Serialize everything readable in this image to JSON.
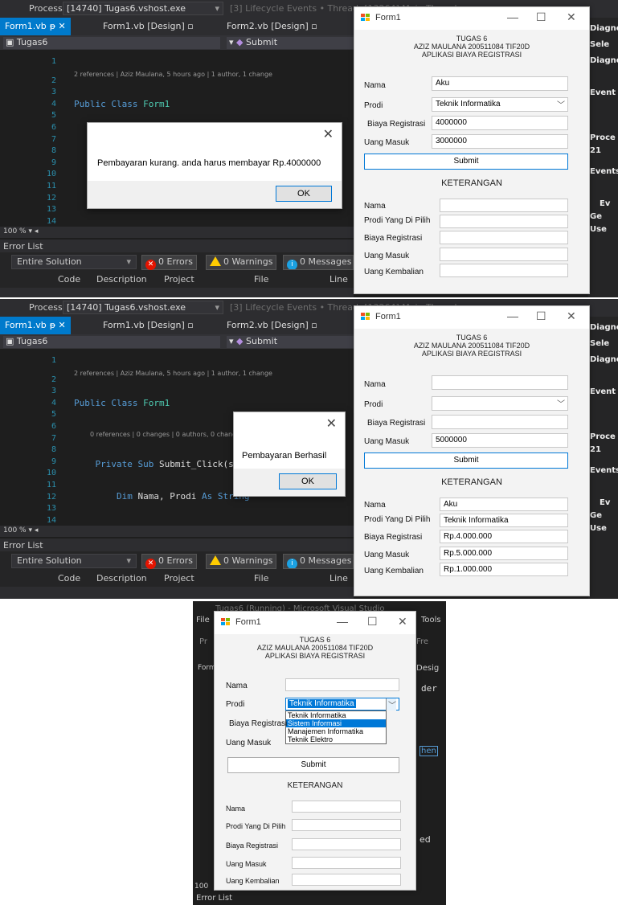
{
  "vs": {
    "process_label": "Process:",
    "process_value": "[14740] Tugas6.vshost.exe",
    "lifecycle": "[3] Lifecycle Events  •  Thread: [13264] Main Thread",
    "tabs": [
      "Form1.vb",
      "Form1.vb [Design]",
      "Form2.vb [Design]"
    ],
    "nav_left": "Tugas6",
    "nav_right": "Submit",
    "codelens_class": "2 references | Aziz Maulana, 5 hours ago | 1 author, 1 change",
    "codelens_sub": "0 references | 0 changes | 0 authors, 0 changes",
    "zoom": "100 %",
    "error_list": "Error List",
    "scope": "Entire Solution",
    "errors": "0 Errors",
    "warnings": "0 Warnings",
    "messages": "0 Messages",
    "cols": [
      "Code",
      "Description",
      "Project",
      "File",
      "Line"
    ],
    "right_panel": [
      "Diagnos",
      "Sele",
      "Diagno",
      "Event",
      "Proce",
      "21",
      "Events",
      "Ev",
      "Ge",
      "Use"
    ]
  },
  "form": {
    "title": "Form1",
    "heading1": "TUGAS 6",
    "heading2": "AZIZ MAULANA 200511084 TIF20D",
    "heading3": "APLIKASI BIAYA REGISTRASI",
    "lbl_nama": "Nama",
    "lbl_prodi": "Prodi",
    "lbl_biaya": "Biaya Registrasi",
    "lbl_uang": "Uang Masuk",
    "submit": "Submit",
    "keterangan": "KETERANGAN",
    "lbl_k_nama": "Nama",
    "lbl_k_prodi": "Prodi Yang Di Pilih",
    "lbl_k_biaya": "Biaya Registrasi",
    "lbl_k_uang": "Uang Masuk",
    "lbl_k_kembali": "Uang Kembalian"
  },
  "shot1": {
    "nama": "Aku",
    "prodi": "Teknik Informatika",
    "biaya": "4000000",
    "uang": "3000000",
    "k_nama": "",
    "k_prodi": "",
    "k_biaya": "",
    "k_uang": "",
    "k_kembali": "",
    "message": "Pembayaran kurang. anda harus membayar Rp.4000000",
    "ok": "OK",
    "code_lines": [
      "1",
      "2",
      "3",
      "4",
      "5",
      "6",
      "7",
      "8",
      "9",
      "10",
      "11",
      "12",
      "13",
      "14"
    ]
  },
  "shot2": {
    "nama": "",
    "prodi": "",
    "biaya": "",
    "uang": "5000000",
    "k_nama": "Aku",
    "k_prodi": "Teknik Informatika",
    "k_biaya": "Rp.4.000.000",
    "k_uang": "Rp.5.000.000",
    "k_kembali": "Rp.1.000.000",
    "message": "Pembayaran Berhasil",
    "ok": "OK"
  },
  "shot3": {
    "vs_title": "Tugas6 (Running) - Microsoft Visual Studio",
    "menu_file": "File",
    "menu_tools": "Tools",
    "prodi_selected": "Teknik Informatika",
    "dropdown_options": [
      "Teknik Informatika",
      "Sistem Informasi",
      "Manajemen Informatika",
      "Teknik Elektro"
    ],
    "highlighted_option": 1,
    "bg_text": [
      "Fre",
      "Desig",
      "der",
      "hen",
      "ed",
      "100",
      "Error List",
      "Pr",
      "Form"
    ]
  },
  "colors": {
    "accent": "#007acc",
    "form_bg": "#f3f3f3",
    "editor_bg": "#1e1e1e",
    "selection": "#0078d7"
  }
}
